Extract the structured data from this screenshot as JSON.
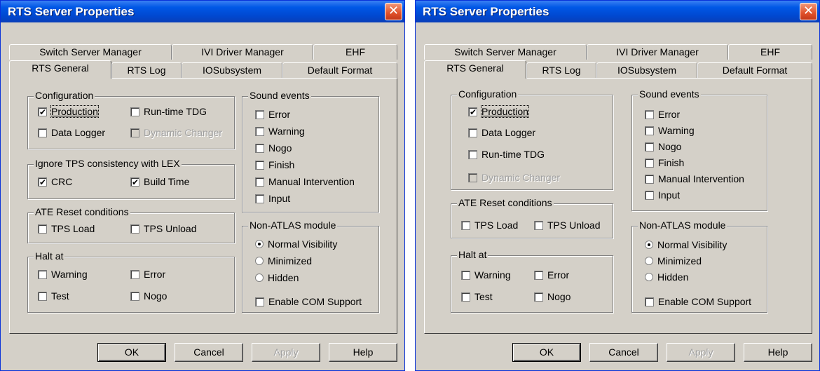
{
  "dialog_a": {
    "title": "RTS Server Properties",
    "close_symbol": "✕",
    "tabs_top": [
      "Switch Server Manager",
      "IVI Driver Manager",
      "EHF"
    ],
    "tabs_bottom": [
      "RTS General",
      "RTS Log",
      "IOSubsystem",
      "Default Format"
    ],
    "active_tab": "RTS General",
    "configuration": {
      "label": "Configuration",
      "production": "Production",
      "runtime_tdg": "Run-time TDG",
      "data_logger": "Data Logger",
      "dynamic_changer": "Dynamic Changer"
    },
    "ignore_tps": {
      "label": "Ignore TPS consistency with LEX",
      "crc": "CRC",
      "build_time": "Build Time"
    },
    "ate_reset": {
      "label": "ATE Reset conditions",
      "tps_load": "TPS Load",
      "tps_unload": "TPS Unload"
    },
    "halt_at": {
      "label": "Halt at",
      "warning": "Warning",
      "error": "Error",
      "test": "Test",
      "nogo": "Nogo"
    },
    "sound_events": {
      "label": "Sound events",
      "items": [
        "Error",
        "Warning",
        "Nogo",
        "Finish",
        "Manual Intervention",
        "Input"
      ]
    },
    "non_atlas": {
      "label": "Non-ATLAS module",
      "normal": "Normal Visibility",
      "minimized": "Minimized",
      "hidden": "Hidden",
      "enable_com": "Enable COM Support"
    },
    "buttons": {
      "ok": "OK",
      "cancel": "Cancel",
      "apply": "Apply",
      "help": "Help"
    }
  },
  "dialog_b": {
    "title": "RTS Server Properties",
    "close_symbol": "✕",
    "tabs_top": [
      "Switch Server Manager",
      "IVI Driver Manager",
      "EHF"
    ],
    "tabs_bottom": [
      "RTS General",
      "RTS Log",
      "IOSubsystem",
      "Default Format"
    ],
    "active_tab": "RTS General",
    "configuration": {
      "label": "Configuration",
      "production": "Production",
      "data_logger": "Data Logger",
      "runtime_tdg": "Run-time TDG",
      "dynamic_changer": "Dynamic Changer"
    },
    "ate_reset": {
      "label": "ATE Reset conditions",
      "tps_load": "TPS Load",
      "tps_unload": "TPS Unload"
    },
    "halt_at": {
      "label": "Halt at",
      "warning": "Warning",
      "error": "Error",
      "test": "Test",
      "nogo": "Nogo"
    },
    "sound_events": {
      "label": "Sound events",
      "items": [
        "Error",
        "Warning",
        "Nogo",
        "Finish",
        "Manual Intervention",
        "Input"
      ]
    },
    "non_atlas": {
      "label": "Non-ATLAS module",
      "normal": "Normal Visibility",
      "minimized": "Minimized",
      "hidden": "Hidden",
      "enable_com": "Enable COM Support"
    },
    "buttons": {
      "ok": "OK",
      "cancel": "Cancel",
      "apply": "Apply",
      "help": "Help"
    }
  },
  "colors": {
    "titlebar": "#0058e6",
    "face": "#d4d0c8",
    "close": "#e0512a"
  }
}
